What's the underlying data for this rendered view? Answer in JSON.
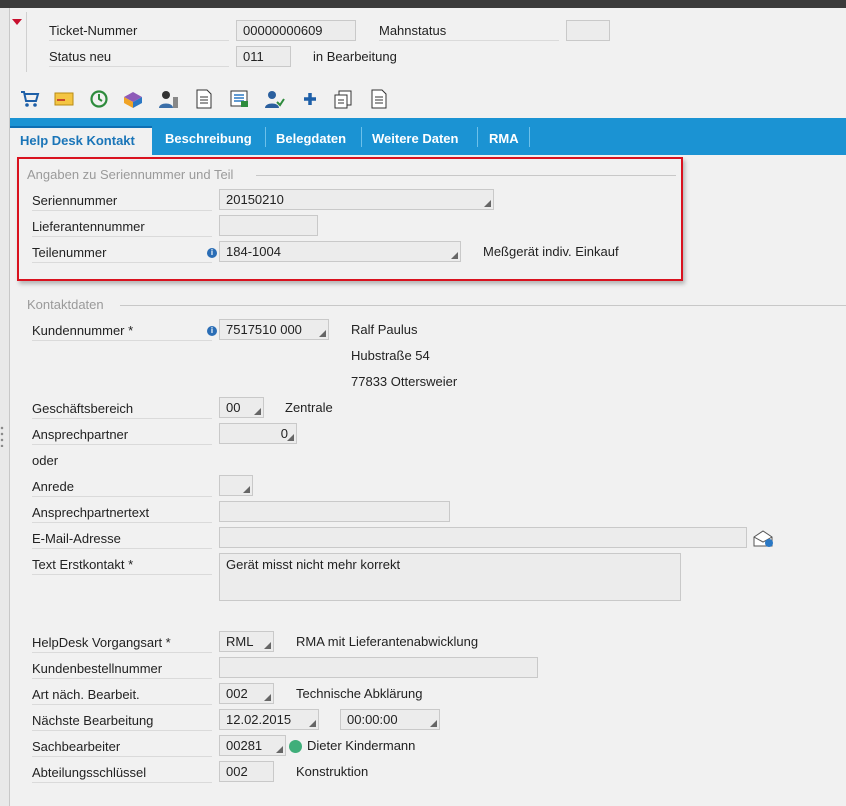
{
  "header": {
    "ticket_label": "Ticket-Nummer",
    "ticket_value": "00000000609",
    "mahnstatus_label": "Mahnstatus",
    "mahnstatus_value": "",
    "status_label": "Status neu",
    "status_value": "011",
    "status_text": "in Bearbeitung"
  },
  "toolbar": {
    "icons": [
      "cart-icon",
      "envelope-icon",
      "history-icon",
      "package-icon",
      "user-icon",
      "document-icon",
      "list-document-icon",
      "technician-icon",
      "plus-icon",
      "copy-document-icon",
      "page-icon"
    ]
  },
  "tabs": [
    "Help Desk Kontakt",
    "Beschreibung",
    "Belegdaten",
    "Weitere Daten",
    "RMA"
  ],
  "serial_group": {
    "title": "Angaben zu Seriennummer und Teil",
    "serial_label": "Seriennummer",
    "serial_value": "20150210",
    "supplier_label": "Lieferantennummer",
    "supplier_value": "",
    "part_label": "Teilenummer",
    "part_value": "184-1004",
    "part_desc": "Meßgerät indiv. Einkauf"
  },
  "contact": {
    "title": "Kontaktdaten",
    "customer_label": "Kundennummer *",
    "customer_value": "7517510 000",
    "customer_name": "Ralf Paulus",
    "customer_street": "Hubstraße 54",
    "customer_city": "77833 Ottersweier",
    "business_label": "Geschäftsbereich",
    "business_value": "00",
    "business_text": "Zentrale",
    "contact_label": "Ansprechpartner",
    "contact_value": "0",
    "or_label": "oder",
    "salutation_label": "Anrede",
    "salutation_value": "",
    "contacttext_label": "Ansprechpartnertext",
    "contacttext_value": "",
    "email_label": "E-Mail-Adresse",
    "email_value": "",
    "firsttext_label": "Text Erstkontakt *",
    "firsttext_value": "Gerät misst nicht mehr korrekt"
  },
  "process": {
    "type_label": "HelpDesk Vorgangsart *",
    "type_value": "RML",
    "type_text": "RMA mit Lieferantenabwicklung",
    "order_label": "Kundenbestellnummer",
    "order_value": "",
    "next_type_label": "Art näch. Bearbeit.",
    "next_type_value": "002",
    "next_type_text": "Technische Abklärung",
    "next_date_label": "Nächste Bearbeitung",
    "next_date_value": "12.02.2015",
    "next_time_value": "00:00:00",
    "agent_label": "Sachbearbeiter",
    "agent_value": "00281",
    "agent_name": "Dieter Kindermann",
    "dept_label": "Abteilungsschlüssel",
    "dept_value": "002",
    "dept_text": "Konstruktion"
  },
  "colors": {
    "tab_bar": "#1b93d3",
    "highlight_border": "#d9121f",
    "status_ok": "#3fae7a"
  }
}
